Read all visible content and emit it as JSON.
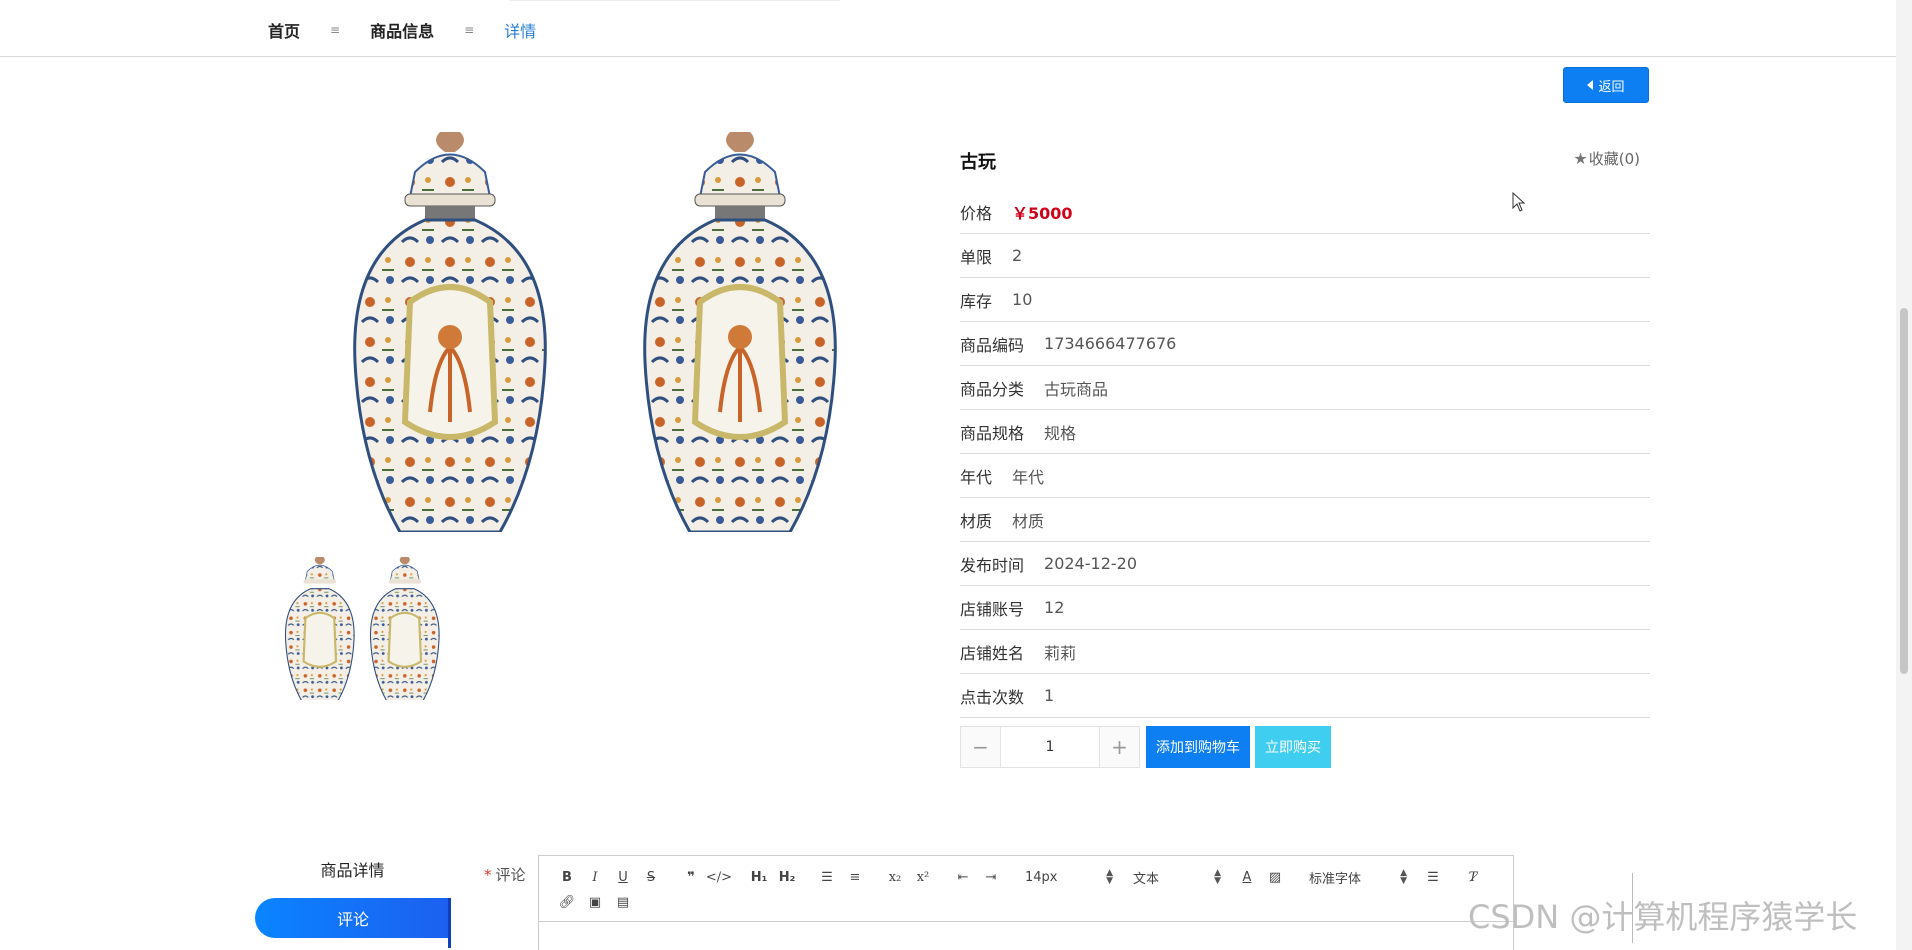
{
  "breadcrumb": {
    "items": [
      "首页",
      "商品信息",
      "详情"
    ],
    "separator": "≡"
  },
  "back_button": {
    "label": "返回"
  },
  "product": {
    "title": "古玩",
    "favorite_label": "收藏(0)",
    "fields": [
      {
        "key": "价格",
        "value": "￥5000",
        "type": "price"
      },
      {
        "key": "单限",
        "value": "2"
      },
      {
        "key": "库存",
        "value": "10"
      },
      {
        "key": "商品编码",
        "value": "1734666477676"
      },
      {
        "key": "商品分类",
        "value": "古玩商品"
      },
      {
        "key": "商品规格",
        "value": "规格"
      },
      {
        "key": "年代",
        "value": "年代"
      },
      {
        "key": "材质",
        "value": "材质"
      },
      {
        "key": "发布时间",
        "value": "2024-12-20"
      },
      {
        "key": "店铺账号",
        "value": "12"
      },
      {
        "key": "店铺姓名",
        "value": "莉莉"
      },
      {
        "key": "点击次数",
        "value": "1"
      }
    ]
  },
  "quantity": {
    "minus": "−",
    "value": "1",
    "plus": "+"
  },
  "buttons": {
    "add_to_cart": "添加到购物车",
    "buy_now": "立即购买"
  },
  "tabs": {
    "detail": "商品详情",
    "comment": "评论"
  },
  "comment": {
    "required_mark": "*",
    "label": "评论",
    "toolbar": {
      "font_size": "14px",
      "heading_type": "文本",
      "font_family": "标准字体"
    }
  },
  "watermark": "CSDN @计算机程序猿学长",
  "colors": {
    "primary": "#0d7ff2",
    "buy": "#3fcdf0",
    "price": "#d0021b",
    "breadcrumb_current": "#2a7fd4"
  }
}
